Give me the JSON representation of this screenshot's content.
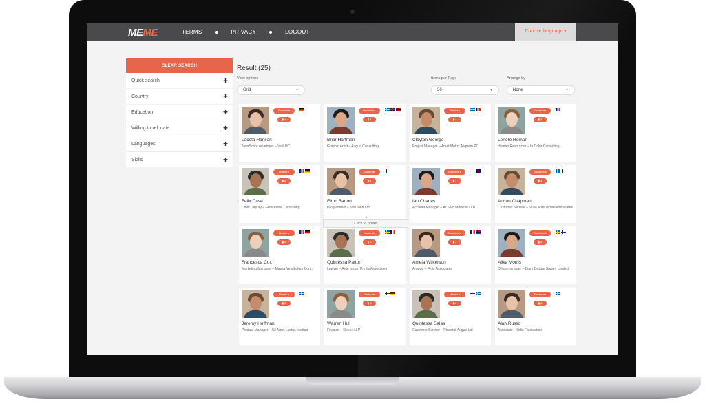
{
  "topbar": {
    "logo_part1": "ME",
    "logo_part2": "ME",
    "nav": [
      "TERMS",
      "PRIVACY",
      "LOGOUT"
    ],
    "language": "Choose language ▾"
  },
  "sidebar": {
    "clear_label": "CLEAR SEARCH",
    "filters": [
      "Quick search",
      "Country",
      "Education",
      "Willing to relocate",
      "Languages",
      "Skills"
    ]
  },
  "main": {
    "result_title": "Result (25)",
    "view_label": "View options",
    "view_value": "Grid",
    "items_label": "Items per Page",
    "items_value": "36",
    "arrange_label": "Arrange by",
    "arrange_value": "None",
    "tooltip": "Click to open!"
  },
  "colors": {
    "accent": "#e8654b",
    "topbar": "#4a4a4c"
  },
  "cards": [
    {
      "name": "Lacota Hanson",
      "role": "JavaScript developer – Velit PC",
      "degree": "Doctorate",
      "count": "1",
      "flags": [
        "de"
      ]
    },
    {
      "name": "Briar Hartman",
      "role": "Graphic Artist – Augue Consulting",
      "degree": "Bachelor's",
      "count": "3",
      "flags": [
        "se",
        "uk",
        "no"
      ]
    },
    {
      "name": "Clayton George",
      "role": "Project Manager – Amet Metus Aliquam PC",
      "degree": "Master's",
      "count": "4",
      "flags": [
        "se",
        "fr"
      ]
    },
    {
      "name": "Lenore Roman",
      "role": "Human Resources – In Dolor Consulting",
      "degree": "Doctorate",
      "count": "3",
      "flags": [
        "fr"
      ]
    },
    {
      "name": "Felix Case",
      "role": "Chief Deputy – Felis Purus Consulting",
      "degree": "Master's",
      "count": "4",
      "flags": [
        "fr",
        "de"
      ]
    },
    {
      "name": "Elton Barton",
      "role": "Programmer – Nisl Nibh Ltd",
      "degree": "Doctorate",
      "count": "4",
      "flags": [
        "fi"
      ]
    },
    {
      "name": "Ian Charles",
      "role": "Account Manager – At Sem Molestie LLP",
      "degree": "Bachelor's",
      "count": "7",
      "flags": [
        "fi",
        "uk"
      ]
    },
    {
      "name": "Adrian Chapman",
      "role": "Customer Service – Nulla Ante Iaculis Associates",
      "degree": "Bachelor's",
      "count": "1",
      "flags": [
        "se",
        "fi"
      ]
    },
    {
      "name": "Francesca Cox",
      "role": "Marketing Manager – Massa Vestibulum Corp.",
      "degree": "Master's",
      "count": "3",
      "flags": [
        "fr",
        "de"
      ]
    },
    {
      "name": "Quintessa Patton",
      "role": "Lawyer – Ante Ipsum Primis Associates",
      "degree": "Doctorate",
      "count": "1",
      "flags": [
        "se",
        "fr"
      ]
    },
    {
      "name": "Amela Wilkerson",
      "role": "Analyst – Felis Associates",
      "degree": "Bachelor's",
      "count": "7",
      "flags": [
        "fr",
        "no"
      ]
    },
    {
      "name": "Alika Morris",
      "role": "Office manager – Diam Dictum Sapien Limited",
      "degree": "Bachelor's",
      "count": "5",
      "flags": [
        "se",
        "fi"
      ]
    },
    {
      "name": "Jeremy Hoffman",
      "role": "Product Manager – Sit Amet Luctus Institute",
      "degree": "Master's",
      "count": "3",
      "flags": [
        "se"
      ]
    },
    {
      "name": "Warren Hull",
      "role": "Finance – Donec LLP",
      "degree": "Doctorate",
      "count": "4",
      "flags": [
        "fi",
        "de"
      ]
    },
    {
      "name": "Quintessa Salas",
      "role": "Customer Service – Placerat Augue Ltd",
      "degree": "Master's",
      "count": "8",
      "flags": [
        "fi",
        "se"
      ]
    },
    {
      "name": "Alan Russo",
      "role": "Associate – Odio Foundation",
      "degree": "Doctorate",
      "count": "4",
      "flags": [
        "se"
      ]
    }
  ]
}
